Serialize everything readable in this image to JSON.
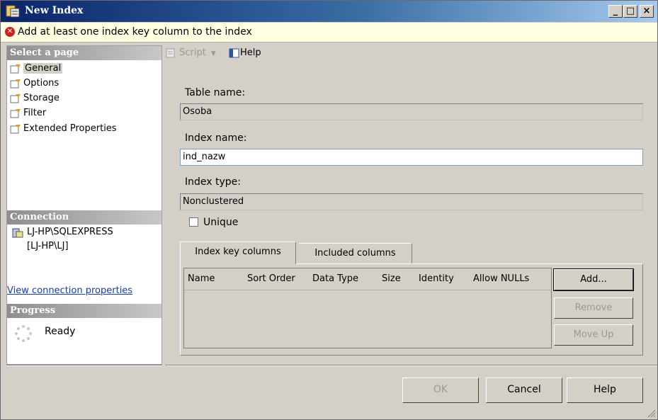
{
  "window": {
    "title": "New Index"
  },
  "error": {
    "message": "Add at least one index key column to the index"
  },
  "left": {
    "select_page_header": "Select a page",
    "pages": [
      {
        "label": "General"
      },
      {
        "label": "Options"
      },
      {
        "label": "Storage"
      },
      {
        "label": "Filter"
      },
      {
        "label": "Extended Properties"
      }
    ],
    "connection_header": "Connection",
    "connection_line1": "LJ-HP\\SQLEXPRESS",
    "connection_line2": "[LJ-HP\\LJ]",
    "view_connection_link": "View connection properties",
    "progress_header": "Progress",
    "progress_status": "Ready"
  },
  "toolbar": {
    "script_label": "Script",
    "help_label": "Help"
  },
  "form": {
    "table_name_label": "Table name:",
    "table_name_value": "Osoba",
    "index_name_label": "Index name:",
    "index_name_value": "ind_nazw",
    "index_type_label": "Index type:",
    "index_type_value": "Nonclustered",
    "unique_label": "Unique",
    "unique_checked": false
  },
  "tabs": [
    {
      "label": "Index key columns",
      "active": true
    },
    {
      "label": "Included columns",
      "active": false
    }
  ],
  "grid": {
    "columns": [
      "Name",
      "Sort Order",
      "Data Type",
      "Size",
      "Identity",
      "Allow NULLs"
    ]
  },
  "side_buttons": {
    "add": "Add...",
    "remove": "Remove",
    "move_up": "Move Up"
  },
  "footer_buttons": {
    "ok": "OK",
    "cancel": "Cancel",
    "help": "Help"
  }
}
